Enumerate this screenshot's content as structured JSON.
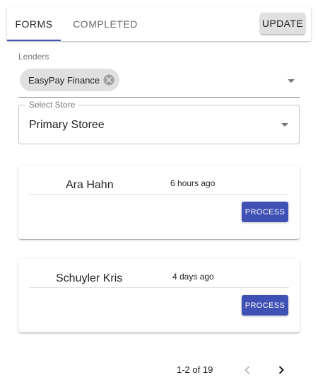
{
  "tabs": [
    {
      "label": "FORMS",
      "active": true
    },
    {
      "label": "COMPLETED",
      "active": false
    }
  ],
  "toolbar": {
    "update_label": "UPDATE"
  },
  "lenders": {
    "label": "Lenders",
    "selected_chip": "EasyPay Finance"
  },
  "store": {
    "label": "Select Store",
    "value": "Primary Storee"
  },
  "cards": [
    {
      "name": "Ara Hahn",
      "time": "6 hours ago",
      "action_label": "PROCESS"
    },
    {
      "name": "Schuyler Kris",
      "time": "4 days ago",
      "action_label": "PROCESS"
    }
  ],
  "pagination": {
    "range_text": "1-2 of 19"
  },
  "icons": {
    "chip_delete": "close-circle-icon",
    "dropdown": "arrow-drop-down-icon",
    "prev": "chevron-left-icon",
    "next": "chevron-right-icon"
  },
  "colors": {
    "primary": "#3f51b5",
    "chip_bg": "#e0e0e0",
    "update_bg": "#e0e0e0"
  }
}
